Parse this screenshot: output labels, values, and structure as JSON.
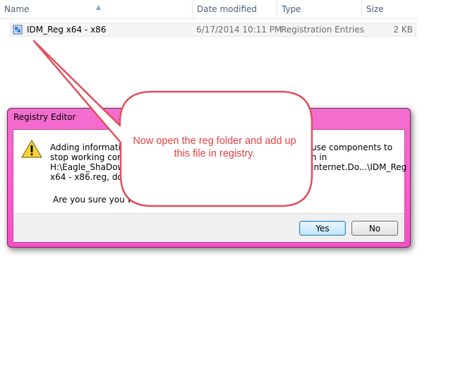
{
  "explorer": {
    "columns": {
      "name": "Name",
      "date_modified": "Date modified",
      "type": "Type",
      "size": "Size"
    },
    "sort_indicator": "^",
    "file": {
      "icon": "registry-file-icon",
      "name": "IDM_Reg x64 - x86",
      "date_modified": "6/17/2014 10:11 PM",
      "type": "Registration Entries",
      "size": "2 KB"
    }
  },
  "dialog": {
    "title": "Registry Editor",
    "icon": "warning-icon",
    "message_lines": [
      "Adding informatio",
      "stop working corre",
      "H:\\Eagle_ShaDow\\",
      "x64 - x86.reg, do no"
    ],
    "message_right_lines": [
      "use components to",
      "n in",
      "Internet.Do...\\IDM_Reg",
      ""
    ],
    "confirm_text": "Are you sure you wa",
    "yes_label": "Yes",
    "no_label": "No"
  },
  "callout": {
    "text": "Now open the reg folder and add up this file in registry.",
    "border_color": "#e0505a",
    "text_color": "#e84040"
  }
}
